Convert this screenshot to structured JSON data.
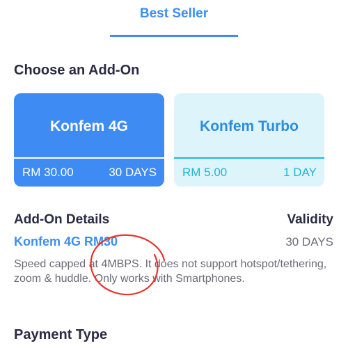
{
  "tab": {
    "label": "Best Seller"
  },
  "choose_title": "Choose an Add-On",
  "addons": [
    {
      "name": "Konfem 4G",
      "price": "RM 30.00",
      "days": "30 DAYS",
      "selected": true
    },
    {
      "name": "Konfem Turbo",
      "price": "RM 5.00",
      "days": "1 DAY",
      "selected": false
    }
  ],
  "details": {
    "heading": "Add-On Details",
    "name": "Konfem 4G RM30",
    "description": "Speed capped at 4MBPS. It does not support hotspot/tethering, zoom & huddle. Only works with Smartphones.",
    "validity_heading": "Validity",
    "validity_value": "30 DAYS"
  },
  "payment_title": "Payment Type",
  "colors": {
    "accent": "#3d8ef0",
    "selected_card": "#3f8bf4",
    "unselected_card": "#ddf4fb",
    "annotation": "#e8332c"
  }
}
